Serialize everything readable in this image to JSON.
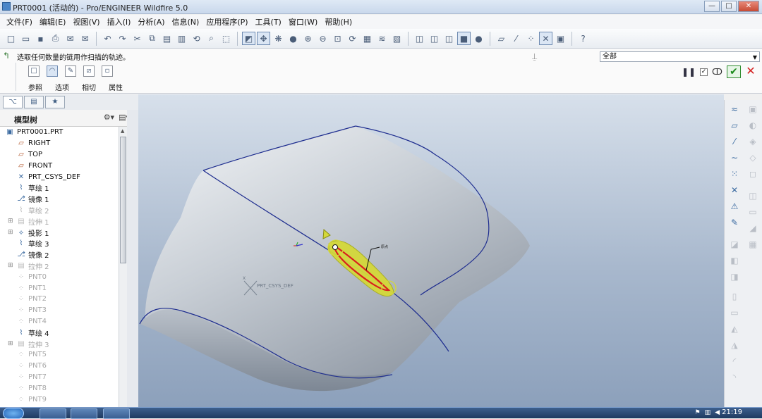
{
  "window": {
    "title": "PRT0001 (活动的) - Pro/ENGINEER Wildfire 5.0",
    "controls": {
      "minimize": "—",
      "maximize": "□",
      "close": "✕"
    }
  },
  "menu": [
    "文件(F)",
    "编辑(E)",
    "视图(V)",
    "插入(I)",
    "分析(A)",
    "信息(N)",
    "应用程序(P)",
    "工具(T)",
    "窗口(W)",
    "帮助(H)"
  ],
  "dashboard": {
    "message": "选取任何数量的链用作扫描的轨迹。",
    "filter_value": "全部",
    "tabs": [
      "参照",
      "选项",
      "相切",
      "属性"
    ]
  },
  "model_tree": {
    "header": "模型树",
    "items": [
      {
        "label": "PRT0001.PRT",
        "icon": "part-icon",
        "state": "normal",
        "expandable": false,
        "root": true
      },
      {
        "label": "RIGHT",
        "icon": "datum-plane-icon",
        "state": "normal",
        "expandable": false
      },
      {
        "label": "TOP",
        "icon": "datum-plane-icon",
        "state": "normal",
        "expandable": false
      },
      {
        "label": "FRONT",
        "icon": "datum-plane-icon",
        "state": "normal",
        "expandable": false
      },
      {
        "label": "PRT_CSYS_DEF",
        "icon": "csys-icon",
        "state": "normal",
        "expandable": false
      },
      {
        "label": "草绘 1",
        "icon": "sketch-icon",
        "state": "normal",
        "expandable": false
      },
      {
        "label": "镜像 1",
        "icon": "mirror-icon",
        "state": "normal",
        "expandable": false
      },
      {
        "label": "草绘 2",
        "icon": "sketch-icon",
        "state": "dim",
        "expandable": false
      },
      {
        "label": "拉伸 1",
        "icon": "extrude-icon",
        "state": "dim",
        "expandable": true
      },
      {
        "label": "投影 1",
        "icon": "projection-icon",
        "state": "normal",
        "expandable": true
      },
      {
        "label": "草绘 3",
        "icon": "sketch-icon",
        "state": "normal",
        "expandable": false
      },
      {
        "label": "镜像 2",
        "icon": "mirror-icon",
        "state": "normal",
        "expandable": false
      },
      {
        "label": "拉伸 2",
        "icon": "extrude-icon",
        "state": "dim",
        "expandable": true
      },
      {
        "label": "PNT0",
        "icon": "point-icon",
        "state": "dim",
        "expandable": false
      },
      {
        "label": "PNT1",
        "icon": "point-icon",
        "state": "dim",
        "expandable": false
      },
      {
        "label": "PNT2",
        "icon": "point-icon",
        "state": "dim",
        "expandable": false
      },
      {
        "label": "PNT3",
        "icon": "point-icon",
        "state": "dim",
        "expandable": false
      },
      {
        "label": "PNT4",
        "icon": "point-icon",
        "state": "dim",
        "expandable": false
      },
      {
        "label": "草绘 4",
        "icon": "sketch-icon",
        "state": "normal",
        "expandable": false
      },
      {
        "label": "拉伸 3",
        "icon": "extrude-icon",
        "state": "dim",
        "expandable": true
      },
      {
        "label": "PNT5",
        "icon": "point-icon",
        "state": "dim",
        "expandable": false
      },
      {
        "label": "PNT6",
        "icon": "point-icon",
        "state": "dim",
        "expandable": false
      },
      {
        "label": "PNT7",
        "icon": "point-icon",
        "state": "dim",
        "expandable": false
      },
      {
        "label": "PNT8",
        "icon": "point-icon",
        "state": "dim",
        "expandable": false
      },
      {
        "label": "PNT9",
        "icon": "point-icon",
        "state": "dim",
        "expandable": false
      }
    ]
  },
  "viewport": {
    "csys_label": "PRT_CSYS_DEF",
    "sweep_label": "原点",
    "colors": {
      "edge": "#1e2d8f",
      "highlight": "#d91e1e",
      "sweep": "#d4d83a"
    }
  },
  "taskbar": {
    "clock": "21:19"
  }
}
